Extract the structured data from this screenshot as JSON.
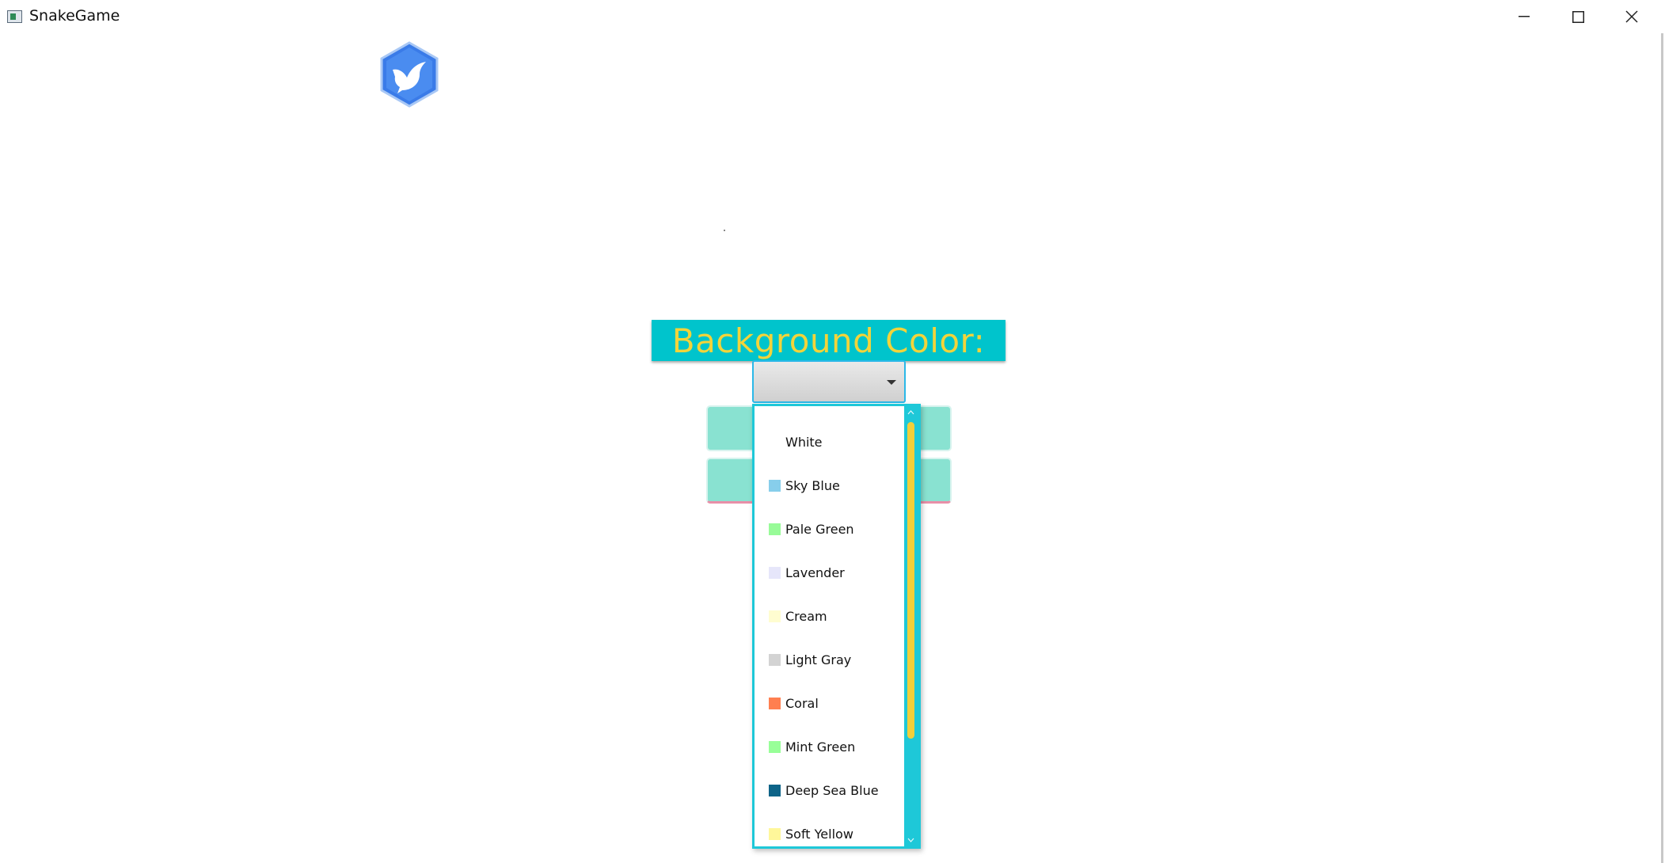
{
  "window": {
    "title": "SnakeGame"
  },
  "settings": {
    "background_label": "Background Color:",
    "combo_selected": ""
  },
  "dropdown": {
    "items": [
      {
        "label": "White",
        "color": "#ffffff"
      },
      {
        "label": "Sky Blue",
        "color": "#87ceeb"
      },
      {
        "label": "Pale Green",
        "color": "#98fb98"
      },
      {
        "label": "Lavender",
        "color": "#e6e6fa"
      },
      {
        "label": "Cream",
        "color": "#fffdd0"
      },
      {
        "label": "Light Gray",
        "color": "#d3d3d3"
      },
      {
        "label": "Coral",
        "color": "#ff7f50"
      },
      {
        "label": "Mint Green",
        "color": "#98ff98"
      },
      {
        "label": "Deep Sea Blue",
        "color": "#0e6488"
      },
      {
        "label": "Soft Yellow",
        "color": "#fff79a"
      }
    ]
  },
  "colors": {
    "accent_teal": "#00c4cc",
    "label_text": "#f2d43a",
    "button_teal": "#89e2d1",
    "scroll_thumb": "#f2cf3a",
    "logo_blue": "#3a7be8"
  },
  "icons": {
    "app": "app-window-icon",
    "logo": "bird-hexagon-logo"
  }
}
